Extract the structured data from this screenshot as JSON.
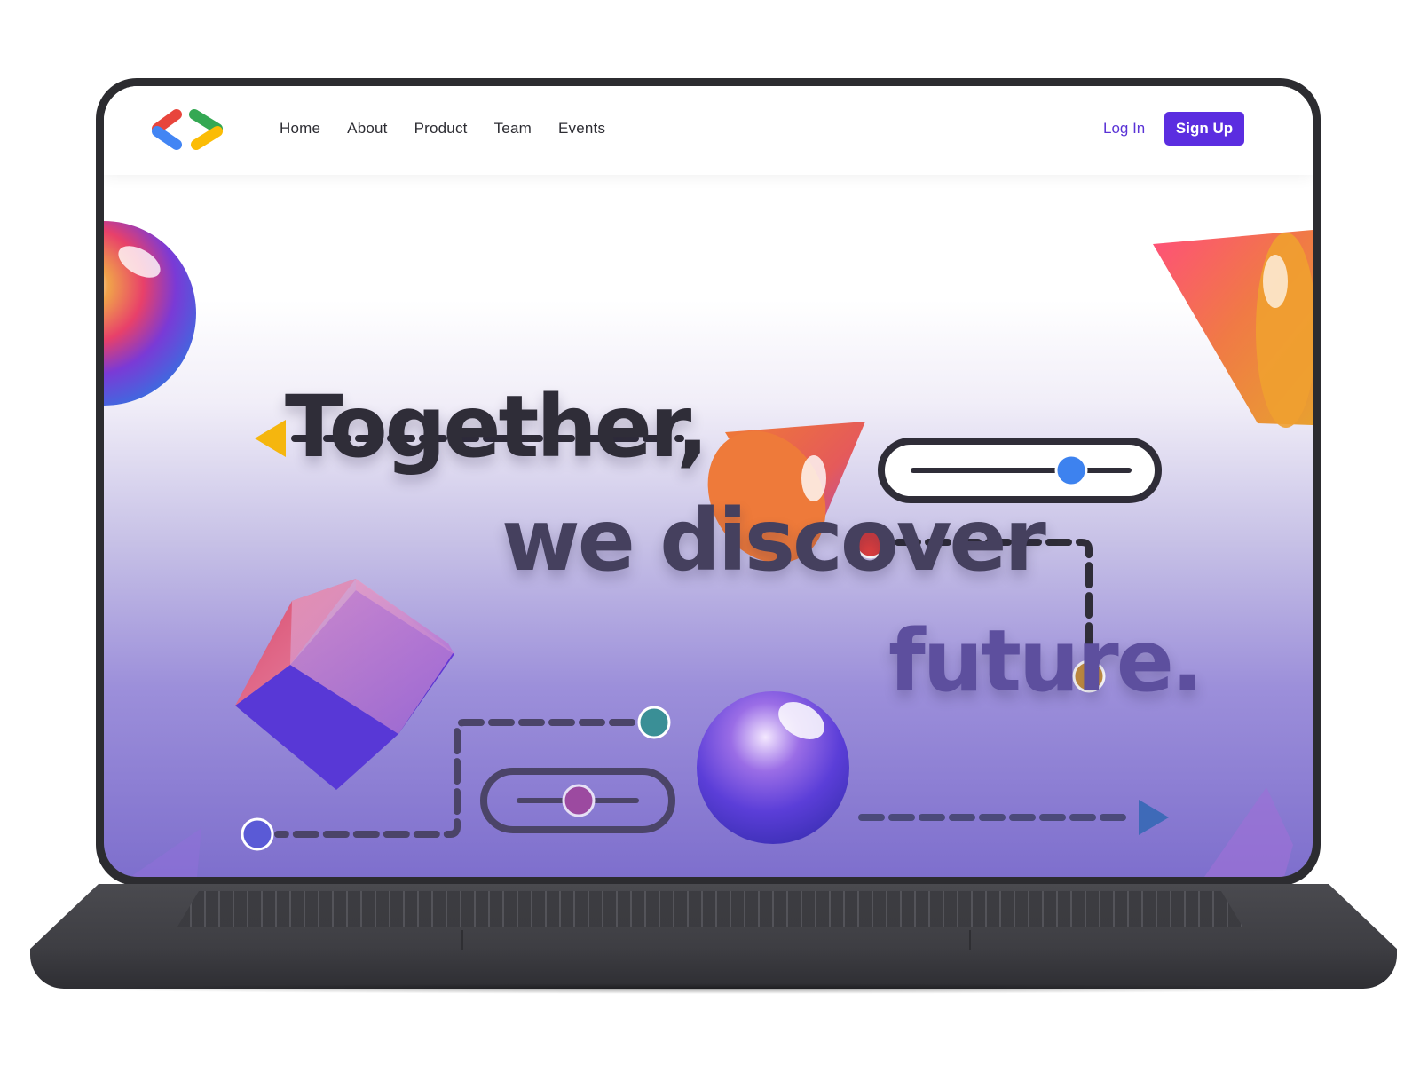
{
  "navbar": {
    "logo_icon": "code-brackets-logo",
    "links": [
      "Home",
      "About",
      "Product",
      "Team",
      "Events"
    ],
    "login_label": "Log In",
    "signup_label": "Sign Up"
  },
  "hero": {
    "line1": "Together,",
    "line2": "we discover",
    "line3": "future."
  },
  "colors": {
    "accent": "#5b2de0",
    "login_text": "#5a33d6",
    "hero_gradient_bottom": "#7e6fcd"
  }
}
